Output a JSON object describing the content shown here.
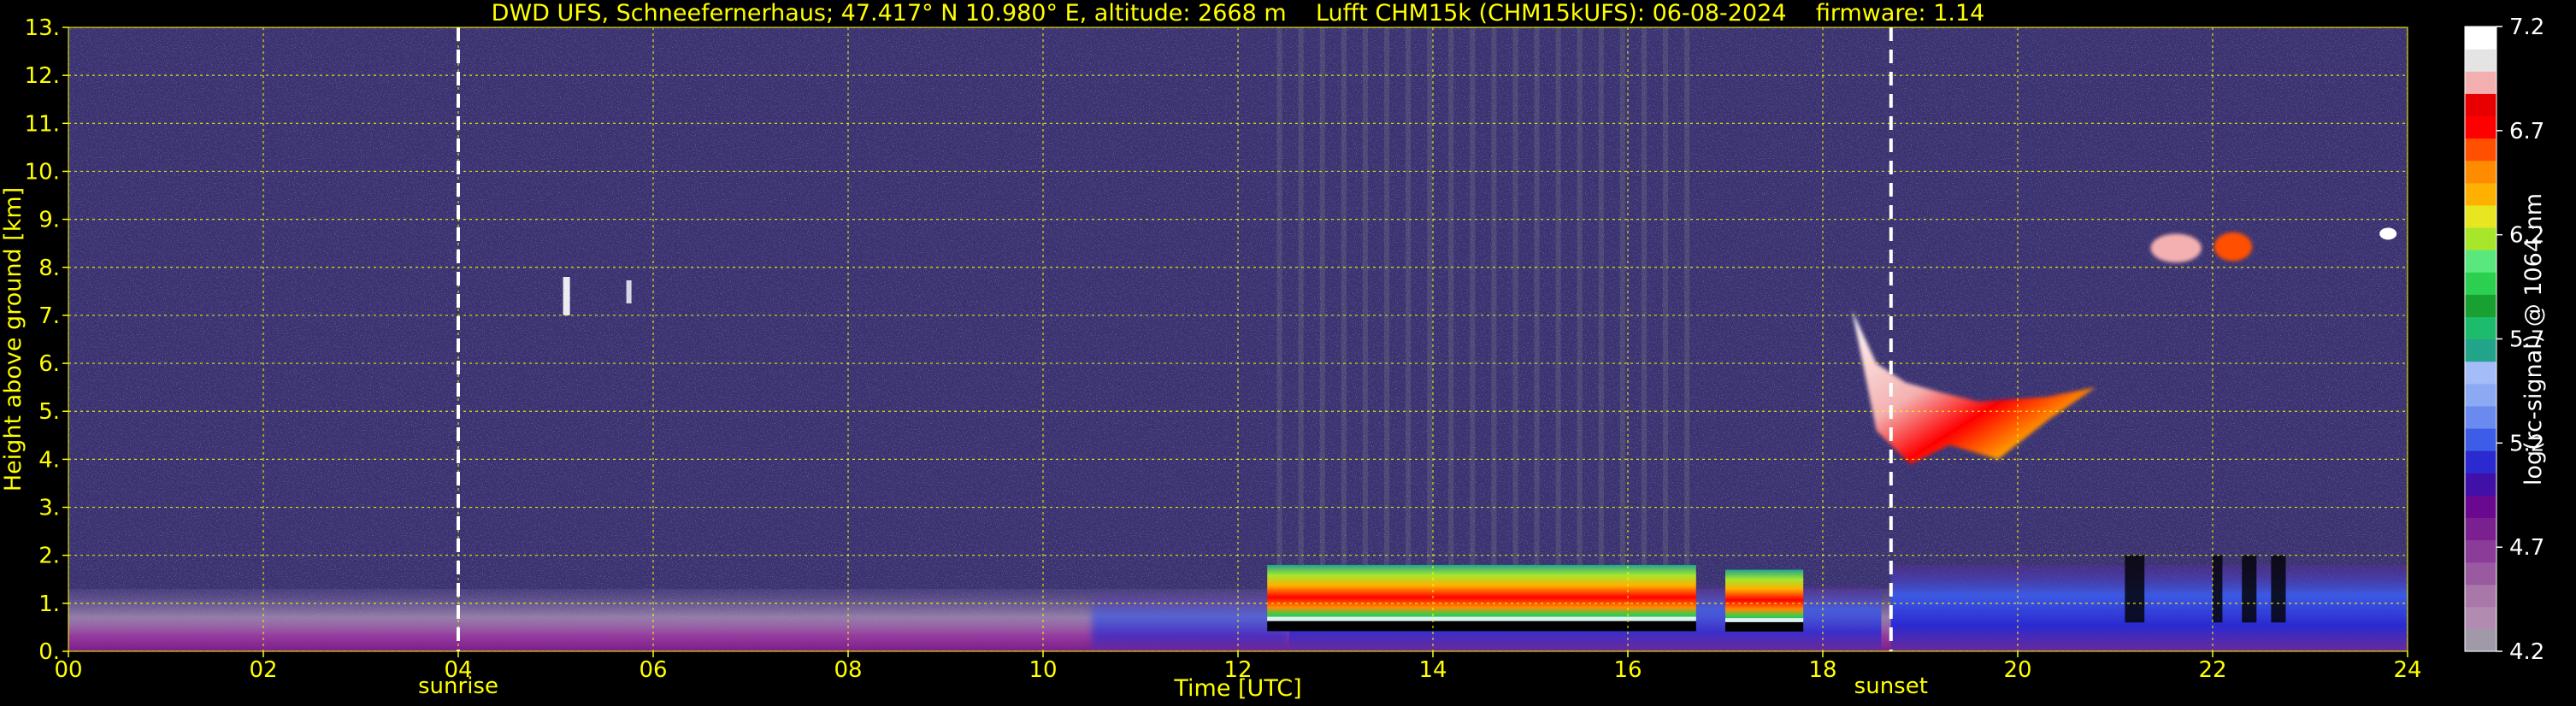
{
  "title": "DWD UFS, Schneefernerhaus; 47.417° N 10.980° E, altitude: 2668 m    Lufft CHM15k (CHM15kUFS): 06-08-2024    firmware: 1.14",
  "chart_data": {
    "type": "heatmap",
    "xlabel": "Time [UTC]",
    "ylabel": "Height above ground [km]",
    "xlim": [
      0,
      24
    ],
    "ylim": [
      0,
      13
    ],
    "x_ticks": [
      {
        "value": 0,
        "label": "00"
      },
      {
        "value": 2,
        "label": "02"
      },
      {
        "value": 4,
        "label": "04"
      },
      {
        "value": 6,
        "label": "06"
      },
      {
        "value": 8,
        "label": "08"
      },
      {
        "value": 10,
        "label": "10"
      },
      {
        "value": 12,
        "label": "12"
      },
      {
        "value": 14,
        "label": "14"
      },
      {
        "value": 16,
        "label": "16"
      },
      {
        "value": 18,
        "label": "18"
      },
      {
        "value": 20,
        "label": "20"
      },
      {
        "value": 22,
        "label": "22"
      },
      {
        "value": 24,
        "label": "24"
      }
    ],
    "y_ticks": [
      {
        "value": 0,
        "label": "0."
      },
      {
        "value": 1,
        "label": "1."
      },
      {
        "value": 2,
        "label": "2."
      },
      {
        "value": 3,
        "label": "3."
      },
      {
        "value": 4,
        "label": "4."
      },
      {
        "value": 5,
        "label": "5."
      },
      {
        "value": 6,
        "label": "6."
      },
      {
        "value": 7,
        "label": "7."
      },
      {
        "value": 8,
        "label": "8."
      },
      {
        "value": 9,
        "label": "9."
      },
      {
        "value": 10,
        "label": "10."
      },
      {
        "value": 11,
        "label": "11."
      },
      {
        "value": 12,
        "label": "12."
      },
      {
        "value": 13,
        "label": "13."
      }
    ],
    "grid": true,
    "grid_color": "#ffff00",
    "background_color": "#3a3270",
    "events": [
      {
        "name": "sunrise",
        "x": 4.0
      },
      {
        "name": "sunset",
        "x": 18.7
      }
    ],
    "colorbar": {
      "label": "log(rc-signal) @ 1064 nm",
      "range": [
        4.2,
        7.2
      ],
      "ticks": [
        {
          "value": 4.2,
          "label": "4.2"
        },
        {
          "value": 4.7,
          "label": "4.7"
        },
        {
          "value": 5.2,
          "label": "5.2"
        },
        {
          "value": 5.7,
          "label": "5.7"
        },
        {
          "value": 6.2,
          "label": "6.2"
        },
        {
          "value": 6.7,
          "label": "6.7"
        },
        {
          "value": 7.2,
          "label": "7.2"
        }
      ],
      "colors": [
        "#a09aa8",
        "#b28cb0",
        "#a978a8",
        "#9a5aa0",
        "#8a3c98",
        "#7a2090",
        "#6a0890",
        "#4010a8",
        "#2a2ad0",
        "#3d5ce8",
        "#6a8af0",
        "#8caaf4",
        "#a4bcf8",
        "#22a48a",
        "#1cbc6c",
        "#18a030",
        "#2cd050",
        "#5ae87c",
        "#a8e62c",
        "#e8e620",
        "#ffb000",
        "#ff8c00",
        "#ff5000",
        "#ff0000",
        "#e80000",
        "#f4b0b0",
        "#e4e4e4",
        "#ffffff"
      ]
    },
    "features": [
      {
        "name": "surface-aerosol-layer",
        "x_range": [
          0,
          24
        ],
        "y_range": [
          0,
          1.3
        ],
        "value": 4.6
      },
      {
        "name": "boundary-layer-blue",
        "x_range": [
          10.5,
          24
        ],
        "y_range": [
          0,
          1.8
        ],
        "value": 5.0
      },
      {
        "name": "convective-clouds-1",
        "x_range": [
          12.3,
          16.7
        ],
        "y_range": [
          0.3,
          1.8
        ],
        "value": 6.4
      },
      {
        "name": "convective-clouds-2",
        "x_range": [
          17.0,
          17.8
        ],
        "y_range": [
          0.3,
          1.7
        ],
        "value": 6.3
      },
      {
        "name": "mid-level-cloud",
        "x_range": [
          18.3,
          20.8
        ],
        "y_range": [
          3.8,
          7.2
        ],
        "value": 6.8
      },
      {
        "name": "cirrus-patch",
        "x_range": [
          21.3,
          22.6
        ],
        "y_range": [
          8.1,
          8.7
        ],
        "value": 6.5
      },
      {
        "name": "early-cirrus",
        "x_range": [
          4.9,
          5.9
        ],
        "y_range": [
          7.0,
          7.8
        ],
        "value": 6.6
      }
    ]
  }
}
